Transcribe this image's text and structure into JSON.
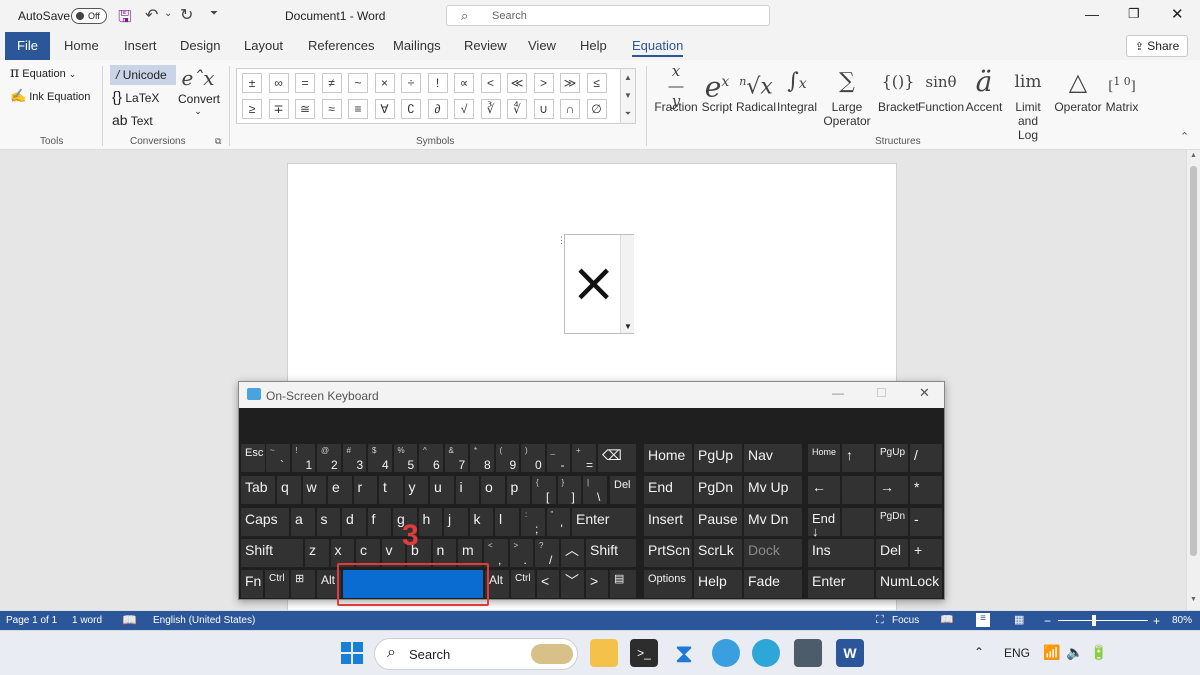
{
  "titlebar": {
    "autosave_label": "AutoSave",
    "autosave_toggle": "Off",
    "doc_title": "Document1  -  Word",
    "search_placeholder": "Search"
  },
  "tabs": [
    "File",
    "Home",
    "Insert",
    "Design",
    "Layout",
    "References",
    "Mailings",
    "Review",
    "View",
    "Help",
    "Equation"
  ],
  "active_tab": "Equation",
  "share_label": "Share",
  "ribbon": {
    "tools": {
      "equation": "Equation",
      "ink_equation": "Ink Equation",
      "label": "Tools"
    },
    "conversions": {
      "unicode": "Unicode",
      "latex": "LaTeX",
      "text": "Text",
      "convert": "Convert",
      "label": "Conversions"
    },
    "symbols": {
      "row1": [
        "±",
        "∞",
        "=",
        "≠",
        "~",
        "×",
        "÷",
        "!",
        "∝",
        "<",
        "≪",
        ">",
        "≫",
        "≤"
      ],
      "row2": [
        "≥",
        "∓",
        "≅",
        "≈",
        "≡",
        "∀",
        "∁",
        "∂",
        "√",
        "∛",
        "∜",
        "∪",
        "∩",
        "∅"
      ],
      "label": "Symbols"
    },
    "structures": {
      "items": [
        {
          "icon": "x/y",
          "label": "Fraction"
        },
        {
          "icon": "eˣ",
          "label": "Script"
        },
        {
          "icon": "ⁿ√x",
          "label": "Radical"
        },
        {
          "icon": "∫ˣ₋ₓ",
          "label": "Integral"
        },
        {
          "icon": "∑",
          "label": "Large\nOperator"
        },
        {
          "icon": "{()}",
          "label": "Bracket"
        },
        {
          "icon": "sinθ",
          "label": "Function"
        },
        {
          "icon": "ä",
          "label": "Accent"
        },
        {
          "icon": "lim",
          "label": "Limit and\nLog"
        },
        {
          "icon": "△",
          "label": "Operator"
        },
        {
          "icon": "[10]",
          "label": "Matrix"
        }
      ],
      "label": "Structures"
    }
  },
  "document": {
    "equation_symbol": "×"
  },
  "status": {
    "page": "Page 1 of 1",
    "words": "1 word",
    "language": "English (United States)",
    "focus": "Focus",
    "zoom": "80%"
  },
  "osk": {
    "title": "On-Screen Keyboard",
    "row1": [
      {
        "t": "~",
        "b": "`"
      },
      {
        "t": "!",
        "b": "1"
      },
      {
        "t": "@",
        "b": "2"
      },
      {
        "t": "#",
        "b": "3"
      },
      {
        "t": "$",
        "b": "4"
      },
      {
        "t": "%",
        "b": "5"
      },
      {
        "t": "^",
        "b": "6"
      },
      {
        "t": "&",
        "b": "7"
      },
      {
        "t": "*",
        "b": "8"
      },
      {
        "t": "(",
        "b": "9"
      },
      {
        "t": ")",
        "b": "0"
      },
      {
        "t": "_",
        "b": "-"
      },
      {
        "t": "+",
        "b": "="
      }
    ],
    "row2": [
      "q",
      "w",
      "e",
      "r",
      "t",
      "y",
      "u",
      "i",
      "o",
      "p"
    ],
    "row2_sym": [
      {
        "t": "{",
        "b": "["
      },
      {
        "t": "}",
        "b": "]"
      },
      {
        "t": "|",
        "b": "\\"
      }
    ],
    "row3": [
      "a",
      "s",
      "d",
      "f",
      "g",
      "h",
      "j",
      "k",
      "l"
    ],
    "row3_sym": [
      {
        "t": ":",
        "b": ";"
      },
      {
        "t": "\"",
        "b": "'"
      }
    ],
    "row4": [
      "z",
      "x",
      "c",
      "v",
      "b",
      "n",
      "m"
    ],
    "row4_sym": [
      {
        "t": "<",
        "b": ","
      },
      {
        "t": ">",
        "b": "."
      },
      {
        "t": "?",
        "b": "/"
      }
    ],
    "labels": {
      "esc": "Esc",
      "bksp": "⌫",
      "tab": "Tab",
      "del": "Del",
      "caps": "Caps",
      "enter": "Enter",
      "shift": "Shift",
      "fn": "Fn",
      "ctrl": "Ctrl",
      "alt": "Alt",
      "home": "Home",
      "pgup": "PgUp",
      "nav": "Nav",
      "end": "End",
      "pgdn": "PgDn",
      "mvup": "Mv Up",
      "insert": "Insert",
      "pause": "Pause",
      "mvdn": "Mv Dn",
      "prtscn": "PrtScn",
      "scrlk": "ScrLk",
      "dock": "Dock",
      "options": "Options",
      "help": "Help",
      "fade": "Fade",
      "ins": "Ins",
      "numlock": "NumLock",
      "np_home": "Home",
      "np_pgup": "PgUp",
      "np_pgdn": "PgDn",
      "np_slash": "/",
      "np_star": "*",
      "np_minus": "-",
      "np_plus": "+"
    },
    "annotation": "3"
  },
  "taskbar": {
    "search": "Search",
    "lang": "ENG"
  }
}
